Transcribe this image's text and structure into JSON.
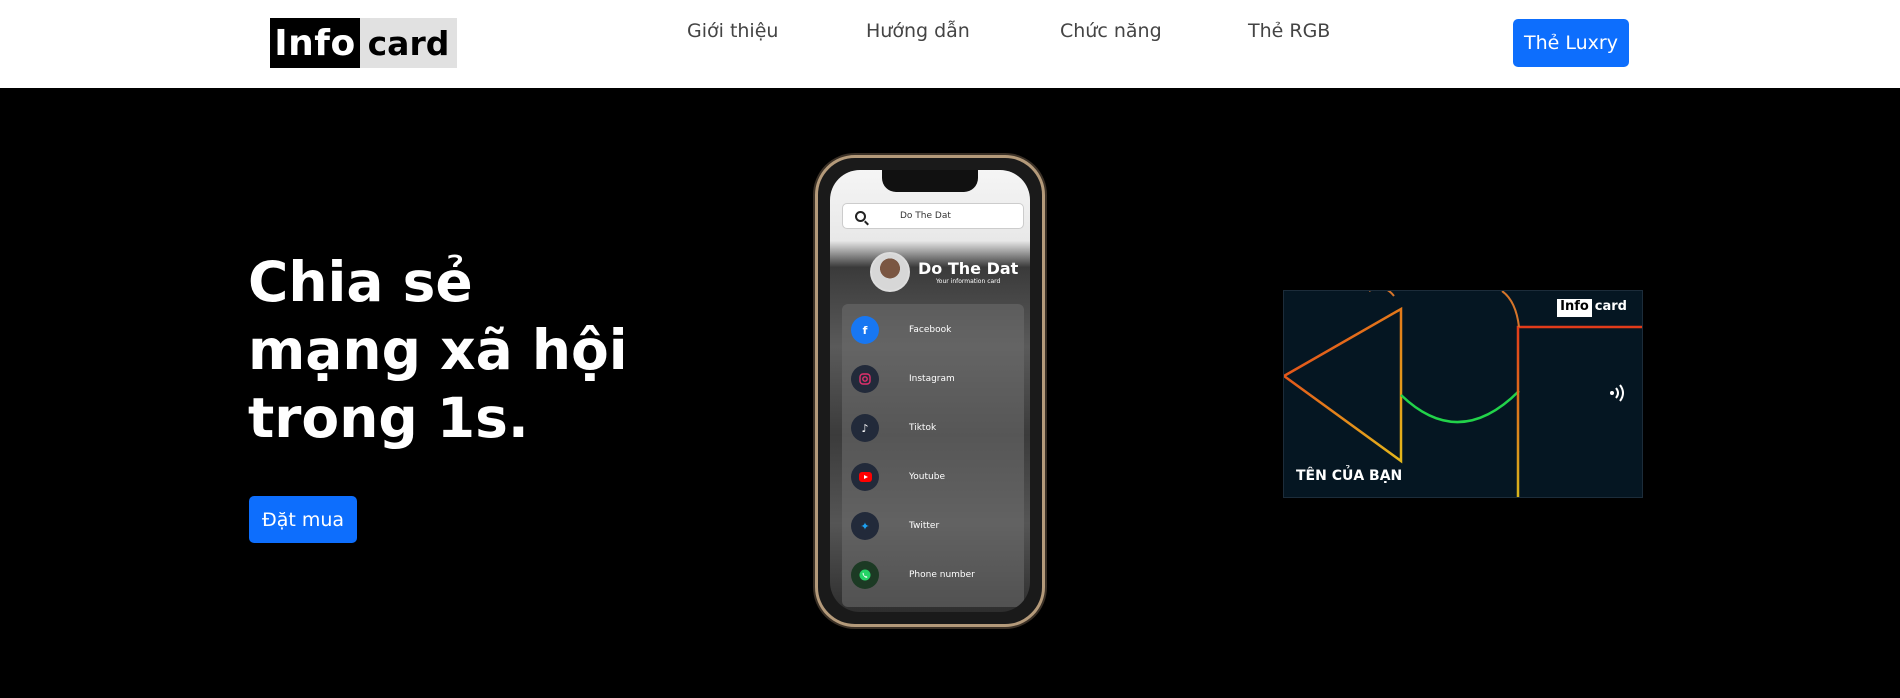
{
  "logo": {
    "part1": "Info",
    "part2": "card"
  },
  "nav": {
    "items": [
      "Giới thiệu",
      "Hướng dẫn",
      "Chức năng",
      "Thẻ RGB"
    ],
    "cta_label": "Thẻ Luxry"
  },
  "hero": {
    "headline_lines": [
      "Chia sẻ",
      "mạng xã hội",
      "trong 1s."
    ],
    "order_button": "Đặt mua"
  },
  "phone": {
    "search_text": "Do The Dat",
    "profile_name": "Do The Dat",
    "profile_subtitle": "Your information card",
    "links": [
      {
        "label": "Facebook",
        "icon": "facebook-icon"
      },
      {
        "label": "Instagram",
        "icon": "instagram-icon"
      },
      {
        "label": "Tiktok",
        "icon": "tiktok-icon"
      },
      {
        "label": "Youtube",
        "icon": "youtube-icon"
      },
      {
        "label": "Twitter",
        "icon": "twitter-icon"
      },
      {
        "label": "Phone number",
        "icon": "phone-icon"
      }
    ]
  },
  "card": {
    "logo_part1": "Info",
    "logo_part2": "card",
    "name_placeholder": "TÊN CỦA BẠN",
    "nfc_icon": "nfc-icon"
  },
  "colors": {
    "primary": "#0d6efd",
    "background": "#000000",
    "card_bg": "#051622"
  }
}
